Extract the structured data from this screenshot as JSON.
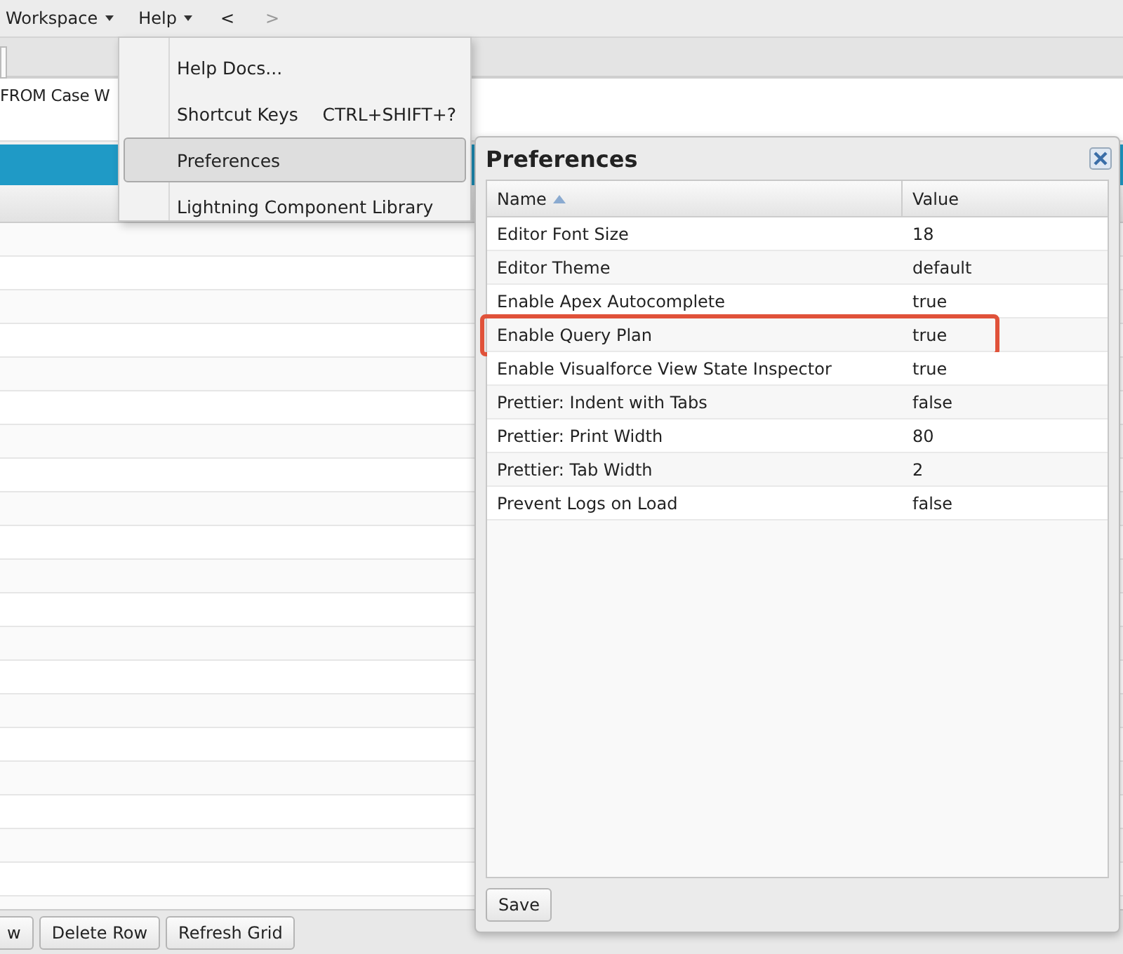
{
  "menubar": {
    "menus": [
      {
        "label": "Workspace"
      },
      {
        "label": "Help"
      }
    ],
    "nav": [
      {
        "label": "<",
        "disabled": false
      },
      {
        "label": ">",
        "disabled": true
      }
    ]
  },
  "editor": {
    "text": "FROM Case W"
  },
  "help_menu": {
    "items": [
      {
        "label": "Help Docs...",
        "selected": false
      },
      {
        "label": "Shortcut Keys",
        "shortcut": "CTRL+SHIFT+?",
        "selected": false
      },
      {
        "label": "Preferences",
        "selected": true
      },
      {
        "label": "Lightning Component Library",
        "selected": false
      }
    ]
  },
  "grid": {
    "buttons": [
      "w",
      "Delete Row",
      "Refresh Grid"
    ]
  },
  "dialog": {
    "title": "Preferences",
    "columns": [
      {
        "label": "Name",
        "sorted": true
      },
      {
        "label": "Value",
        "sorted": false
      }
    ],
    "rows": [
      {
        "name": "Editor Font Size",
        "value": "18",
        "highlighted": false
      },
      {
        "name": "Editor Theme",
        "value": "default",
        "highlighted": false
      },
      {
        "name": "Enable Apex Autocomplete",
        "value": "true",
        "highlighted": false
      },
      {
        "name": "Enable Query Plan",
        "value": "true",
        "highlighted": true
      },
      {
        "name": "Enable Visualforce View State Inspector",
        "value": "true",
        "highlighted": false
      },
      {
        "name": "Prettier: Indent with Tabs",
        "value": "false",
        "highlighted": false
      },
      {
        "name": "Prettier: Print Width",
        "value": "80",
        "highlighted": false
      },
      {
        "name": "Prettier: Tab Width",
        "value": "2",
        "highlighted": false
      },
      {
        "name": "Prevent Logs on Load",
        "value": "false",
        "highlighted": false
      }
    ],
    "buttons": [
      "Save"
    ]
  }
}
